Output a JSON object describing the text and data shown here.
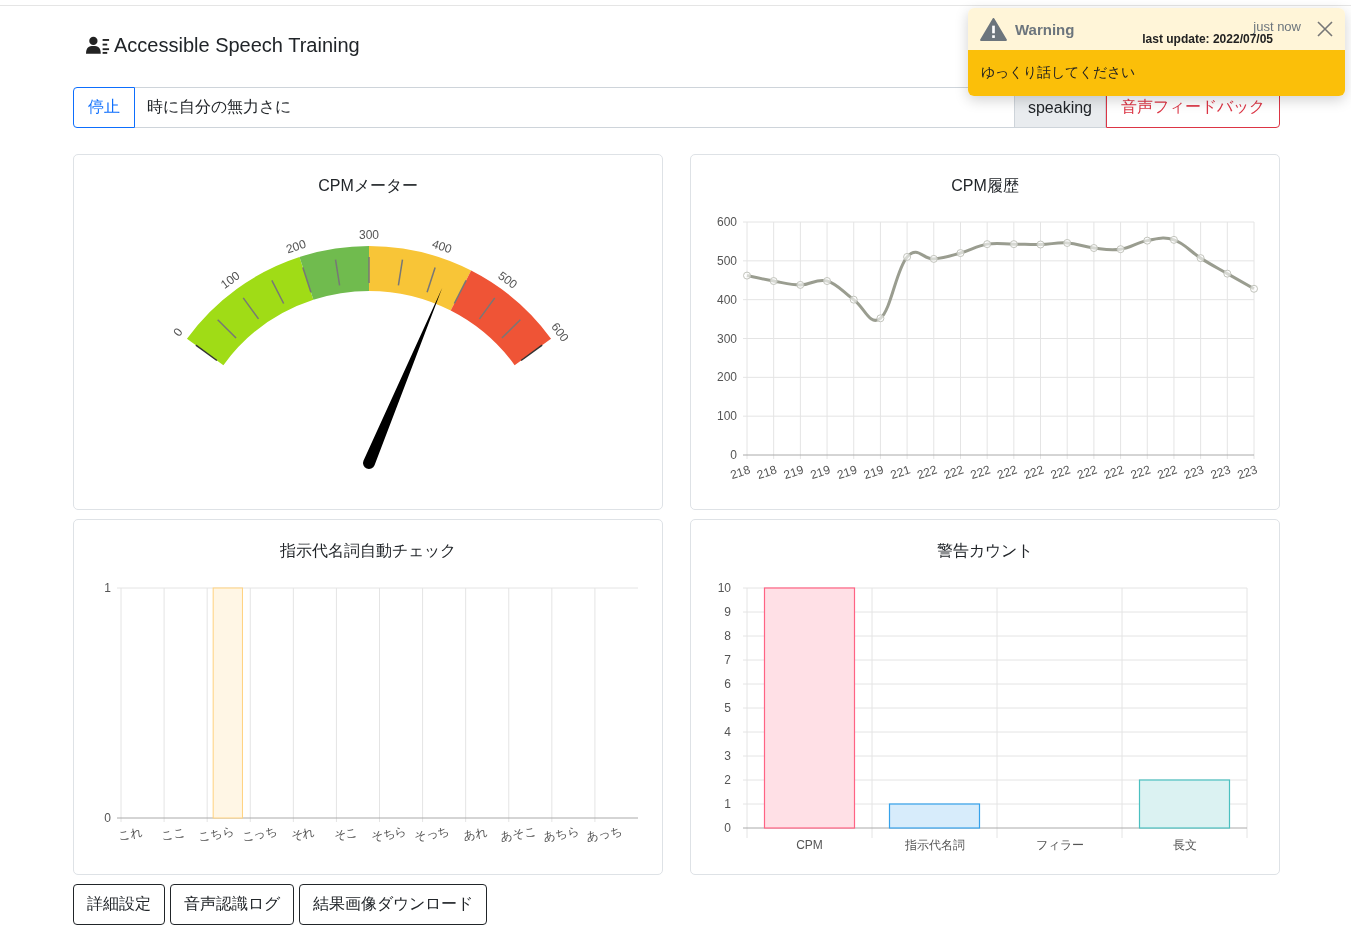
{
  "header": {
    "title": "Accessible Speech Training"
  },
  "controls": {
    "stop_button": "停止",
    "transcript": "時に自分の無力さに",
    "status": "speaking",
    "feedback_button": "音声フィードバック"
  },
  "toast": {
    "title": "Warning",
    "time": "just now",
    "subtitle": "last update: 2022/07/05",
    "message": "ゆっくり話してください"
  },
  "cpm_meter": {
    "title": "CPMメーター",
    "ticks": [
      "0",
      "100",
      "200",
      "300",
      "400",
      "500",
      "600"
    ]
  },
  "cpm_history": {
    "title": "CPM履歴",
    "chart_data": {
      "type": "line",
      "categories": [
        "218",
        "218",
        "219",
        "219",
        "219",
        "219",
        "221",
        "222",
        "222",
        "222",
        "222",
        "222",
        "222",
        "222",
        "222",
        "222",
        "222",
        "223",
        "223",
        "223"
      ],
      "series": [
        {
          "color": "#9a9d90",
          "marker": true,
          "values": [
            462,
            448,
            438,
            448,
            400,
            352,
            510,
            505,
            520,
            543,
            543,
            542,
            546,
            533,
            530,
            552,
            554,
            507,
            467,
            428
          ]
        }
      ],
      "ylim": [
        0,
        600
      ],
      "yticks": [
        0,
        100,
        200,
        300,
        400,
        500,
        600
      ],
      "grid": true
    }
  },
  "demonstrative_check": {
    "title": "指示代名詞自動チェック",
    "chart_data": {
      "type": "bar",
      "categories": [
        "これ",
        "ここ",
        "こちら",
        "こっち",
        "それ",
        "そこ",
        "そちら",
        "そっち",
        "あれ",
        "あそこ",
        "あちら",
        "あっち"
      ],
      "series": [
        {
          "color": "#ffd27f",
          "values": [
            0,
            0,
            1,
            0,
            0,
            0,
            0,
            0,
            0,
            0,
            0,
            0
          ]
        }
      ],
      "ylim": [
        0,
        1
      ],
      "yticks": [
        0,
        1
      ],
      "grid": true
    }
  },
  "warning_count": {
    "title": "警告カウント",
    "chart_data": {
      "type": "bar",
      "categories": [
        "CPM",
        "指示代名詞",
        "フィラー",
        "長文"
      ],
      "series": [
        {
          "color": "#ff6384",
          "values": [
            10,
            null,
            0,
            null
          ]
        },
        {
          "color": "#36a2eb",
          "values": [
            null,
            1,
            null,
            null
          ]
        },
        {
          "color": "#4bc0c0",
          "values": [
            null,
            null,
            null,
            2
          ]
        }
      ],
      "ylim": [
        0,
        10
      ],
      "yticks": [
        0,
        1,
        2,
        3,
        4,
        5,
        6,
        7,
        8,
        9,
        10
      ],
      "grid": true
    }
  },
  "buttons": [
    "詳細設定",
    "音声認識ログ",
    "結果画像ダウンロード"
  ]
}
